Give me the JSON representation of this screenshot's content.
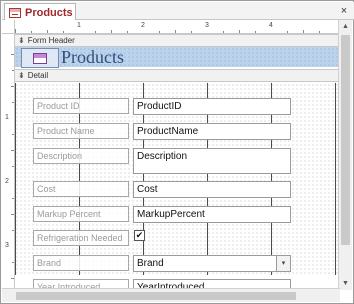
{
  "tab": {
    "label": "Products",
    "icon": "form-icon",
    "close": "×"
  },
  "sections": {
    "form_header": "Form Header",
    "detail": "Detail"
  },
  "header": {
    "title": "Products",
    "logo_icon": "form-logo-icon"
  },
  "ruler": {
    "h_numbers": [
      "1",
      "2",
      "3",
      "4"
    ],
    "v_numbers": [
      "1",
      "2",
      "3"
    ]
  },
  "fields": {
    "product_id": {
      "label": "Product ID",
      "value": "ProductID"
    },
    "product_name": {
      "label": "Product Name",
      "value": "ProductName"
    },
    "description": {
      "label": "Description",
      "value": "Description"
    },
    "cost": {
      "label": "Cost",
      "value": "Cost"
    },
    "markup_percent": {
      "label": "Markup Percent",
      "value": "MarkupPercent"
    },
    "refrigeration_needed": {
      "label": "Refrigeration Needed",
      "checked": true,
      "mark": "✔"
    },
    "brand": {
      "label": "Brand",
      "value": "Brand",
      "dropdown": "▾"
    },
    "year_introduced": {
      "label": "Year Introduced",
      "value": "YearIntroduced"
    }
  },
  "colors": {
    "tab_text": "#a0282a",
    "header_band": "#bcd3ec",
    "title_text": "#2f4f7f"
  }
}
